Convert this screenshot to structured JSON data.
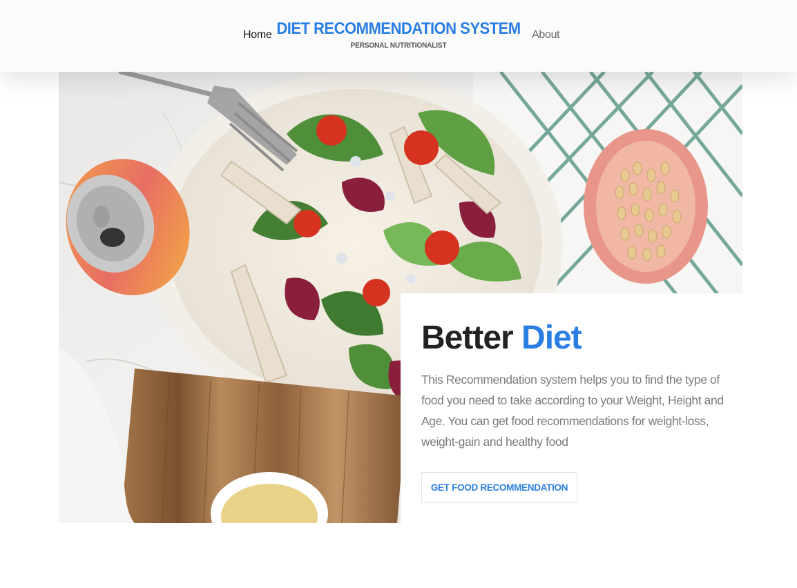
{
  "nav": {
    "home_label": "Home",
    "about_label": "About",
    "brand_title": "DIET RECOMMENDATION SYSTEM",
    "brand_subtitle": "PERSONAL NUTRITIONALIST"
  },
  "hero": {
    "image_subject": "salad-bowl-photo"
  },
  "card": {
    "heading_part1": "Better",
    "heading_part2": "Diet",
    "description": "This Recommendation system helps you to find the type of food you need to take according to your Weight, Height and Age. You can get food recommendations for weight-loss, weight-gain and healthy food",
    "cta_label": "GET FOOD RECOMMENDATION"
  },
  "colors": {
    "accent": "#2a7ee3",
    "heading": "#222222",
    "body_text": "#7a7a7a"
  }
}
